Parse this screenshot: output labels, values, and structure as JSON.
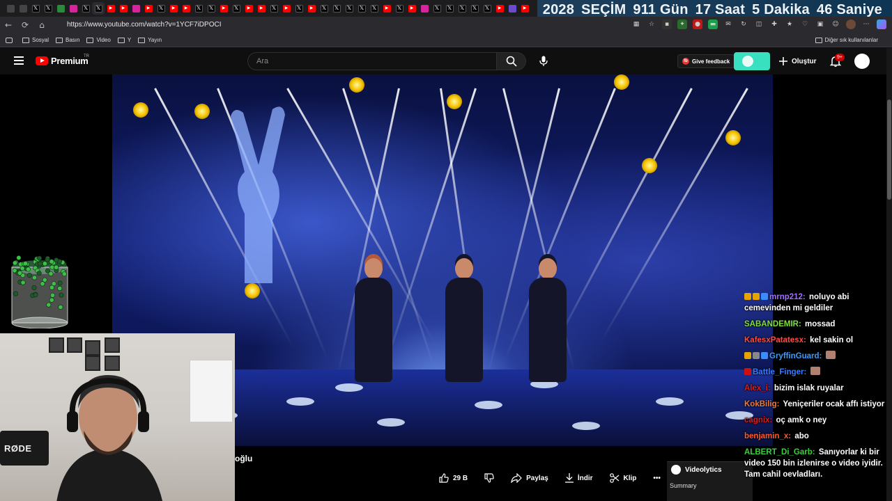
{
  "countdown": {
    "year": "2028",
    "label": "SEÇİM",
    "days": "911",
    "days_unit": "Gün",
    "hours": "17",
    "hours_unit": "Saat",
    "minutes": "5",
    "minutes_unit": "Dakika",
    "seconds": "46",
    "seconds_unit": "Saniye"
  },
  "browser": {
    "url": "https://www.youtube.com/watch?v=1YCF7iDPOCI",
    "tab_icons": [
      "x-icon",
      "youtube-icon",
      "instagram-icon",
      "close-icon"
    ],
    "bookmarks": [
      {
        "label": "Sosyal"
      },
      {
        "label": "Basın"
      },
      {
        "label": "Video"
      },
      {
        "label": "Y"
      },
      {
        "label": "Yayın"
      }
    ],
    "other_bookmarks": "Diğer sık kullanılanlar"
  },
  "youtube": {
    "brand": "Premium",
    "region": "TR",
    "search_placeholder": "Ara",
    "feedback_label": "Give feedback",
    "create_label": "Oluştur",
    "notification_count": "9+"
  },
  "video": {
    "subtitle_fragment": "oğlu"
  },
  "webcam": {
    "mic_brand": "RØDE"
  },
  "actions": {
    "like_count": "29 B",
    "share_label": "Paylaş",
    "download_label": "İndir",
    "clip_label": "Klip",
    "more_label": "•••"
  },
  "videolytics": {
    "title": "Videolytics",
    "summary_label": "Summary"
  },
  "chat": [
    {
      "user": "mrnp212:",
      "user_color": "#a070ff",
      "text": "noluyo abi cemevinden mi geldiler",
      "badges": [
        "#e6a400",
        "#e6a400",
        "#3b8cff"
      ]
    },
    {
      "user": "SABANDEMIR:",
      "user_color": "#7ee03a",
      "text": "mossad",
      "badges": []
    },
    {
      "user": "KafesxPatatesx:",
      "user_color": "#ff4a4a",
      "text": "kel sakin ol",
      "badges": []
    },
    {
      "user": "GryffinGuard:",
      "user_color": "#3b9cff",
      "text": "",
      "badges": [
        "#e6a400",
        "#888888",
        "#3b8cff"
      ]
    },
    {
      "user": "Battle_Finger:",
      "user_color": "#3b7bff",
      "text": "",
      "badges": [
        "#d01010"
      ]
    },
    {
      "user": "Alex_i:",
      "user_color": "#e01a1a",
      "text": "bizim islak ruyalar",
      "badges": []
    },
    {
      "user": "KokBilig:",
      "user_color": "#f07a3a",
      "text": "Yeniçeriler ocak affı istiyor",
      "badges": []
    },
    {
      "user": "cagnix:",
      "user_color": "#e01a1a",
      "text": "oç amk o ney",
      "badges": []
    },
    {
      "user": "benjamin_x:",
      "user_color": "#ff5a2a",
      "text": "abo",
      "badges": []
    },
    {
      "user": "ALBERT_Di_Garb:",
      "user_color": "#3ad23a",
      "text": "Sanıyorlar ki bir video 150 bin izlenirse o video iyidir. Tam cahil oevladları.",
      "badges": []
    }
  ],
  "colors": {
    "youtube_red": "#ff0000",
    "accent_toggle": "#38e0c0",
    "notification_badge": "#cc0000"
  }
}
